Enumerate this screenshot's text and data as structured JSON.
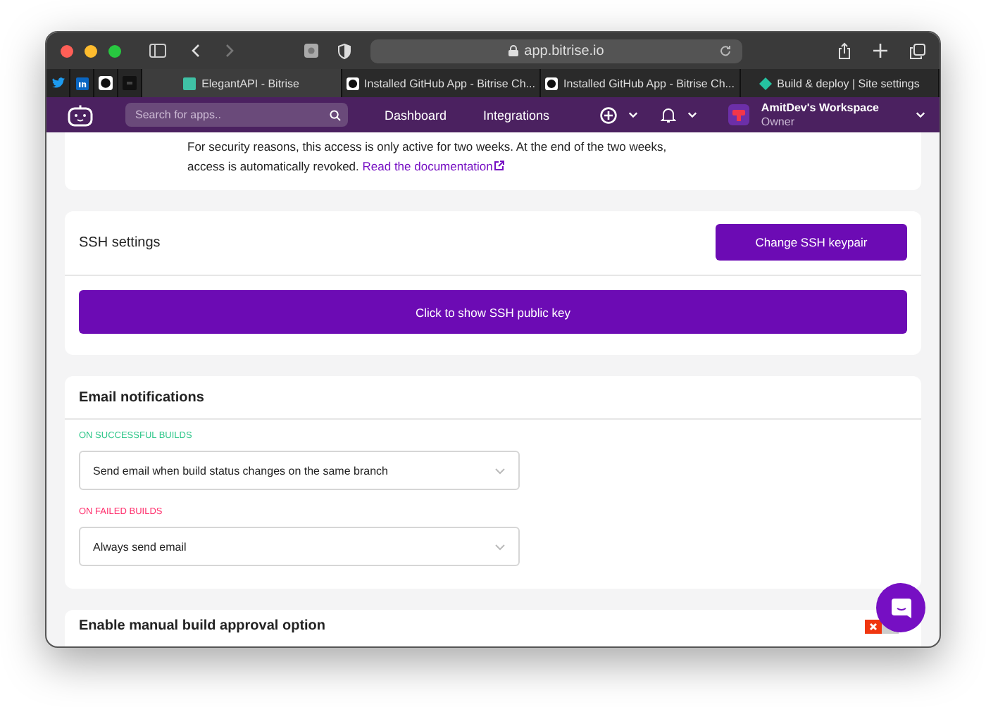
{
  "browser": {
    "address": "app.bitrise.io",
    "pinned_tabs": [
      {
        "kind": "twitter"
      },
      {
        "kind": "linkedin"
      },
      {
        "kind": "github"
      },
      {
        "kind": "dark"
      }
    ],
    "tabs": [
      {
        "label": "ElegantAPI - Bitrise",
        "kind": "square",
        "selected": true
      },
      {
        "label": "Installed GitHub App - Bitrise Ch...",
        "kind": "github",
        "selected": false
      },
      {
        "label": "Installed GitHub App - Bitrise Ch...",
        "kind": "github",
        "selected": false
      },
      {
        "label": "Build & deploy | Site settings",
        "kind": "diamond",
        "selected": false
      }
    ]
  },
  "nav": {
    "search_placeholder": "Search for apps..",
    "links": [
      "Dashboard",
      "Integrations"
    ],
    "workspace": "AmitDev's Workspace",
    "role": "Owner"
  },
  "access_notice": {
    "text": "For security reasons, this access is only active for two weeks. At the end of the two weeks, access is automatically revoked.",
    "link": "Read the documentation"
  },
  "ssh": {
    "title": "SSH settings",
    "change_button": "Change SSH keypair",
    "show_button": "Click to show SSH public key"
  },
  "email": {
    "title": "Email notifications",
    "groups": [
      {
        "label": "ON SUCCESSFUL BUILDS",
        "color": "#2fc78a",
        "value": "Send email when build status changes on the same branch"
      },
      {
        "label": "ON FAILED BUILDS",
        "color": "#ff2e6c",
        "value": "Always send email"
      }
    ]
  },
  "approval": {
    "title": "Enable manual build approval option",
    "on": false
  }
}
